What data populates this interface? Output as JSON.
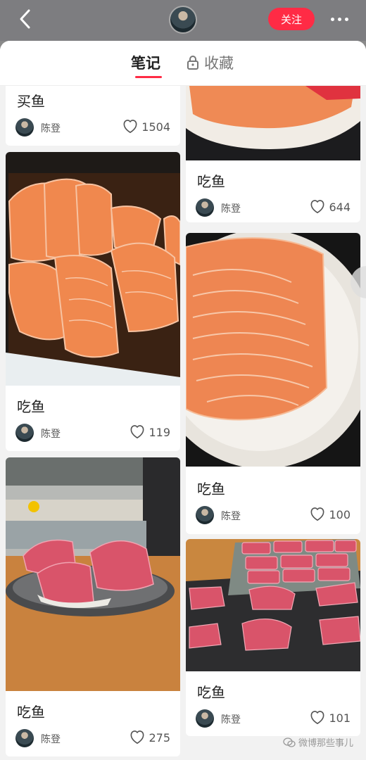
{
  "header": {
    "follow_label": "关注"
  },
  "tabs": {
    "notes_label": "笔记",
    "collect_label": "收藏"
  },
  "cards": [
    {
      "title": "买鱼",
      "author": "陈登",
      "likes": "1504"
    },
    {
      "title": "吃鱼",
      "author": "陈登",
      "likes": "644"
    },
    {
      "title": "吃鱼",
      "author": "陈登",
      "likes": "119"
    },
    {
      "title": "吃鱼",
      "author": "陈登",
      "likes": "100"
    },
    {
      "title": "吃鱼",
      "author": "陈登",
      "likes": "275"
    },
    {
      "title": "吃鱼",
      "author": "陈登",
      "likes": "101"
    }
  ],
  "watermark": "微博那些事儿",
  "colors": {
    "accent": "#ff2b45",
    "salmon": "#f08a55",
    "tuna": "#d9546a"
  },
  "icons": [
    "back-arrow-icon",
    "more-icon",
    "lock-icon",
    "heart-icon",
    "wechat-icon"
  ]
}
